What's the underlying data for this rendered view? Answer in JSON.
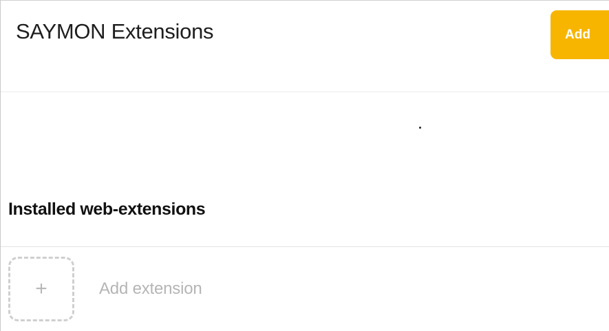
{
  "header": {
    "title": "SAYMON Extensions",
    "add_label": "Add"
  },
  "installed": {
    "section_title": "Installed web-extensions",
    "add_extension_label": "Add extension",
    "add_extension_icon": "plus-icon"
  },
  "colors": {
    "accent": "#f7b500"
  }
}
